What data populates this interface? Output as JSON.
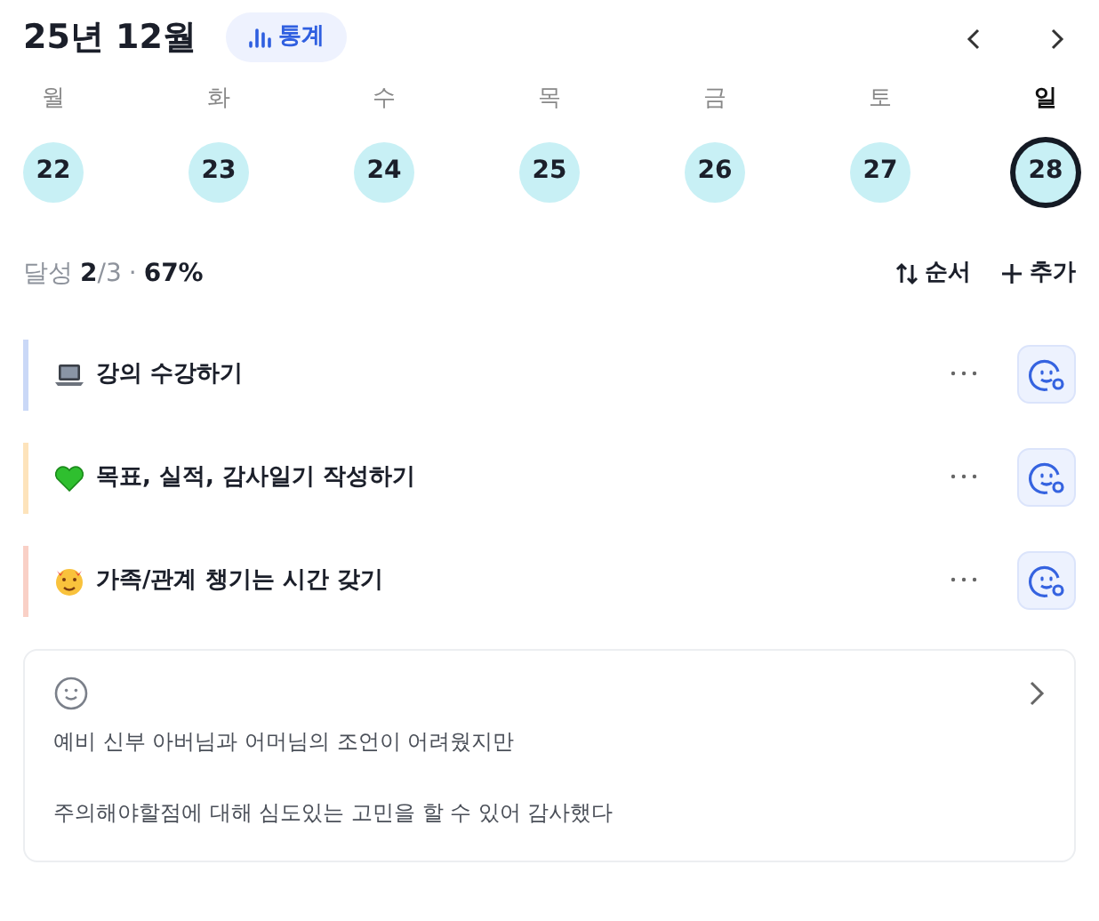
{
  "header": {
    "title": "25년 12월",
    "stats_button": "통계"
  },
  "days": [
    {
      "weekday": "월",
      "date": "22",
      "selected": false
    },
    {
      "weekday": "화",
      "date": "23",
      "selected": false
    },
    {
      "weekday": "수",
      "date": "24",
      "selected": false
    },
    {
      "weekday": "목",
      "date": "25",
      "selected": false
    },
    {
      "weekday": "금",
      "date": "26",
      "selected": false
    },
    {
      "weekday": "토",
      "date": "27",
      "selected": false
    },
    {
      "weekday": "일",
      "date": "28",
      "selected": true
    }
  ],
  "summary": {
    "label": "달성",
    "done": "2",
    "total": "/3",
    "separator": "·",
    "percent": "67%"
  },
  "actions": [
    "순서",
    "추가"
  ],
  "tasks": [
    {
      "title": "강의 수강하기",
      "color": "#cad8f7"
    },
    {
      "title": "목표, 실적, 감사일기 작성하기",
      "color": "#fde3bb"
    },
    {
      "title": "가족/관계 챙기는 시간 갖기",
      "color": "#f9d0c6"
    }
  ],
  "note": {
    "lines": [
      "예비 신부 아버님과 어머님의 조언이 어려웠지만",
      "주의해야할점에 대해 심도있는 고민을 할 수 있어 감사했다"
    ]
  }
}
